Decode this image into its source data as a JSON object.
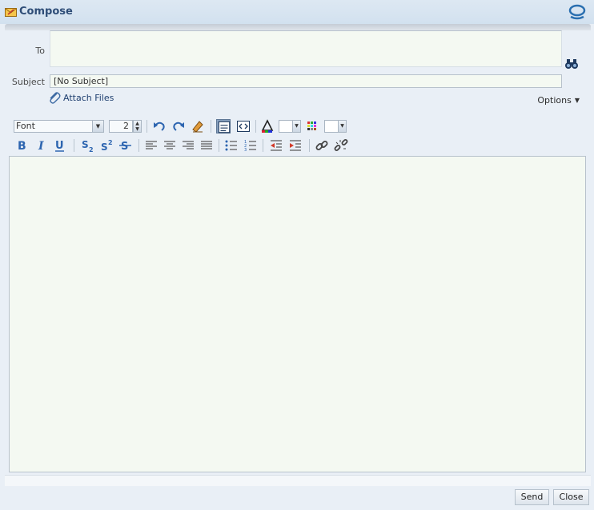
{
  "window": {
    "title": "Compose"
  },
  "form": {
    "to_label": "To",
    "to_value": "",
    "subject_label": "Subject",
    "subject_value": "[No Subject]",
    "attach_label": "Attach Files",
    "options_label": "Options"
  },
  "editor": {
    "font_select": "Font",
    "font_size": "2",
    "body": ""
  },
  "actions": {
    "send_label": "Send",
    "close_label": "Close"
  },
  "icons": [
    "compose-icon",
    "brand-icon",
    "binoculars-icon",
    "paperclip-icon",
    "undo-icon",
    "redo-icon",
    "eraser-icon",
    "rich-text-mode-icon",
    "source-mode-icon",
    "font-color-icon",
    "background-color-icon",
    "bold-icon",
    "italic-icon",
    "underline-icon",
    "subscript-icon",
    "superscript-icon",
    "strikethrough-icon",
    "align-left-icon",
    "align-center-icon",
    "align-right-icon",
    "justify-icon",
    "bulleted-list-icon",
    "numbered-list-icon",
    "outdent-icon",
    "indent-icon",
    "link-icon",
    "unlink-icon"
  ],
  "colors": {
    "title_text": "#2e4d77",
    "background": "#e9eff6",
    "field_background": "#f4f9f2",
    "link": "#204070"
  }
}
